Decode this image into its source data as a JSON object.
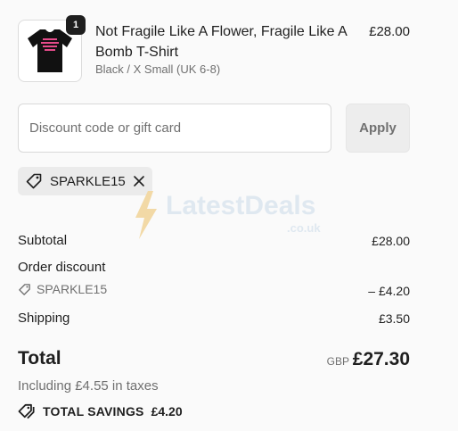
{
  "product": {
    "quantity": "1",
    "title": "Not Fragile Like A Flower, Fragile Like A Bomb T-Shirt",
    "variant": "Black / X Small (UK 6-8)",
    "price": "£28.00"
  },
  "discount": {
    "placeholder": "Discount code or gift card",
    "value": "",
    "apply_label": "Apply",
    "applied_code": "SPARKLE15"
  },
  "watermark": {
    "brand": "LatestDeals",
    "suffix": ".co.uk"
  },
  "summary": {
    "subtotal_label": "Subtotal",
    "subtotal_value": "£28.00",
    "order_discount_label": "Order discount",
    "discount_code": "SPARKLE15",
    "discount_value": "– £4.20",
    "shipping_label": "Shipping",
    "shipping_value": "£3.50",
    "total_label": "Total",
    "currency": "GBP",
    "total_value": "£27.30",
    "tax_note": "Including £4.55 in taxes",
    "savings_label": "TOTAL SAVINGS",
    "savings_value": "£4.20"
  },
  "colors": {
    "text": "#1f1f1f",
    "muted": "#707070",
    "chip_bg": "#ebebeb",
    "button_bg": "#ededed",
    "watermark_bolt": "#f2d9a6",
    "tshirt_print": "#e54b8a"
  }
}
